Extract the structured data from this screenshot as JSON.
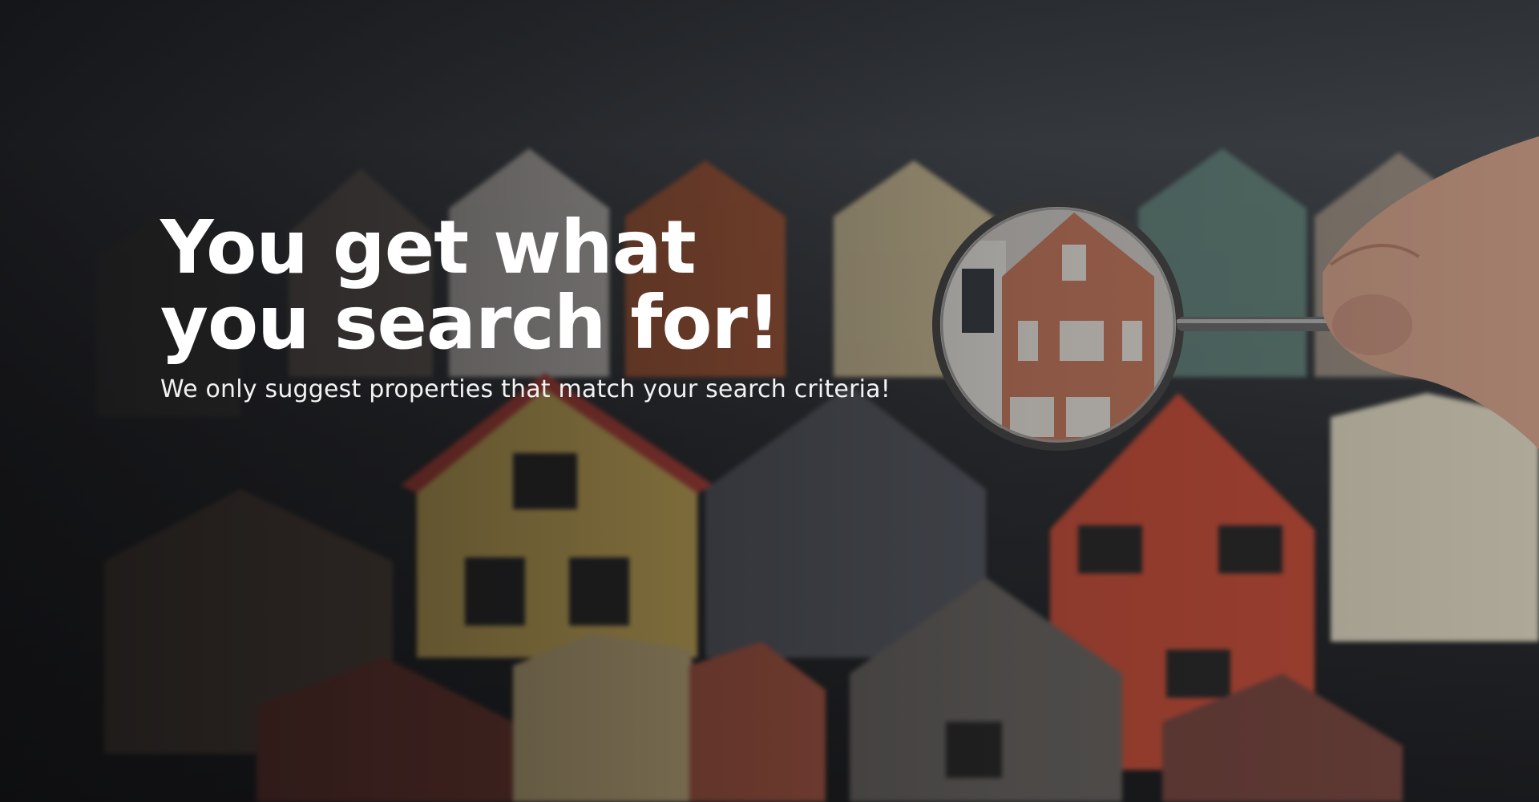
{
  "hero": {
    "title_line1": "You get what",
    "title_line2": "you search for!",
    "subtitle": "We only suggest properties that match your search criteria!"
  },
  "colors": {
    "title": "#ffffff",
    "subtitle": "#f2f2f2",
    "overlay": "#0a0a0c"
  },
  "background": {
    "icon": "houses-magnifying-glass-photo"
  }
}
